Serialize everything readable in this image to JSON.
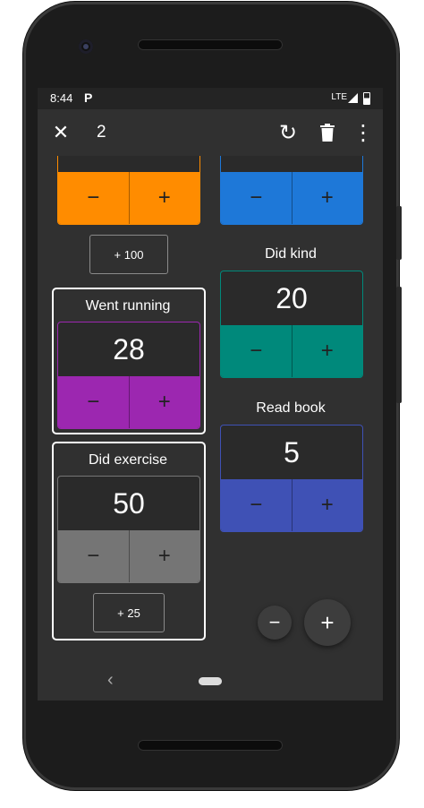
{
  "status_bar": {
    "time": "8:44",
    "app_glyph": "P",
    "network": "LTE",
    "signal_icon": "signal-icon",
    "battery_icon": "battery-icon"
  },
  "toolbar": {
    "close_glyph": "✕",
    "selected_count": "2",
    "undo_glyph": "↻",
    "delete_glyph": "🗑",
    "more_glyph": "⋮"
  },
  "counters": {
    "orange": {
      "minus": "−",
      "plus": "+",
      "color": "#FF8C00"
    },
    "blue": {
      "minus": "−",
      "plus": "+",
      "color": "#1E78D8"
    },
    "went_running": {
      "title": "Went running",
      "value": "28",
      "minus": "−",
      "plus": "+",
      "color": "#9C27B0"
    },
    "did_kind": {
      "title": "Did kind",
      "value": "20",
      "minus": "−",
      "plus": "+",
      "color": "#00897B"
    },
    "read_book": {
      "title": "Read book",
      "value": "5",
      "minus": "−",
      "plus": "+",
      "color": "#3F51B5"
    },
    "did_exercise": {
      "title": "Did exercise",
      "value": "50",
      "minus": "−",
      "plus": "+",
      "color": "#757575"
    }
  },
  "increment_buttons": {
    "plus_100": "+ 100",
    "plus_25": "+ 25"
  },
  "fabs": {
    "minus": "−",
    "plus": "+"
  },
  "nav": {
    "back_glyph": "‹"
  }
}
